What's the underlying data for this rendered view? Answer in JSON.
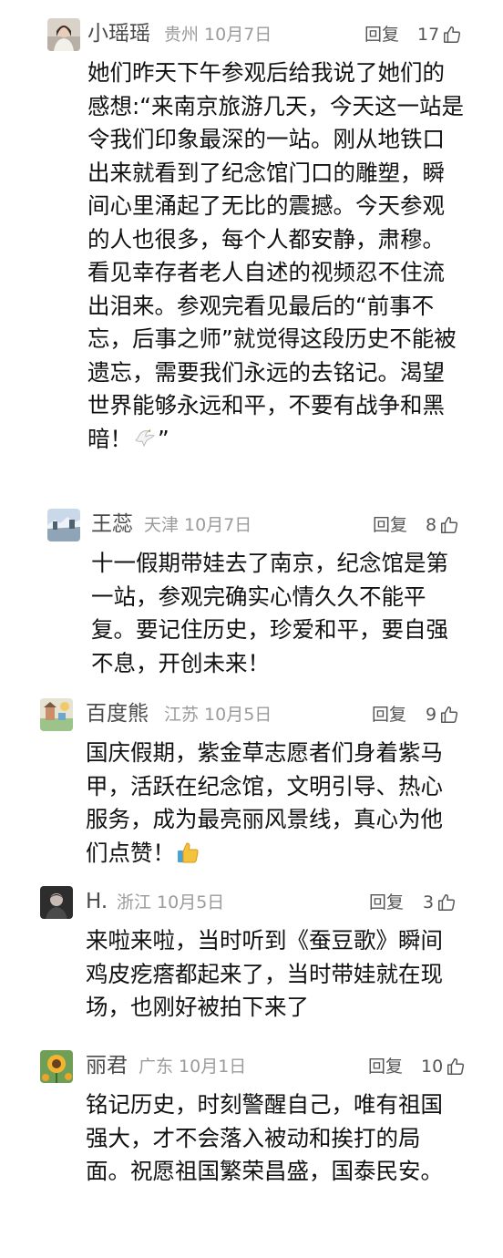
{
  "comments": [
    {
      "name": "小瑶瑶",
      "location": "贵州",
      "date": "10月7日",
      "reply_label": "回复",
      "likes": "17",
      "avatar_icon": "avatar-woman-portrait",
      "text": "她们昨天下午参观后给我说了她们的感想:“来南京旅游几天，今天这一站是令我们印象最深的一站。刚从地铁口出来就看到了纪念馆门口的雕塑，瞬间心里涌起了无比的震撼。今天参观的人也很多，每个人都安静，肃穆。看见幸存者老人自述的视频忍不住流出泪来。参观完看见最后的“前事不忘，后事之师”就觉得这段历史不能被遗忘，需要我们永远的去铭记。渴望世界能够永远和平，不要有战争和黑暗！",
      "text_tail": "”",
      "emoji": "dove-emoji"
    },
    {
      "name": "王蕊",
      "location": "天津",
      "date": "10月7日",
      "reply_label": "回复",
      "likes": "8",
      "avatar_icon": "avatar-snow-landscape",
      "text": "十一假期带娃去了南京，纪念馆是第一站，参观完确实心情久久不能平复。要记住历史，珍爱和平，要自强不息，开创未来！"
    },
    {
      "name": "百度熊",
      "location": "江苏",
      "date": "10月5日",
      "reply_label": "回复",
      "likes": "9",
      "avatar_icon": "avatar-illustration",
      "text": "国庆假期，紫金草志愿者们身着紫马甲，活跃在纪念馆，文明引导、热心服务，成为最亮丽风景线，真心为他们点赞！",
      "emoji": "thumbs-up-emoji"
    },
    {
      "name": "H.",
      "location": "浙江",
      "date": "10月5日",
      "reply_label": "回复",
      "likes": "3",
      "avatar_icon": "avatar-dark-portrait",
      "text": "来啦来啦，当时听到《蚕豆歌》瞬间鸡皮疙瘩都起来了，当时带娃就在现场，也刚好被拍下来了"
    },
    {
      "name": "丽君",
      "location": "广东",
      "date": "10月1日",
      "reply_label": "回复",
      "likes": "10",
      "avatar_icon": "avatar-sunflower",
      "text": "铭记历史，时刻警醒自己，唯有祖国强大，才不会落入被动和挨打的局面。祝愿祖国繁荣昌盛，国泰民安。"
    }
  ]
}
